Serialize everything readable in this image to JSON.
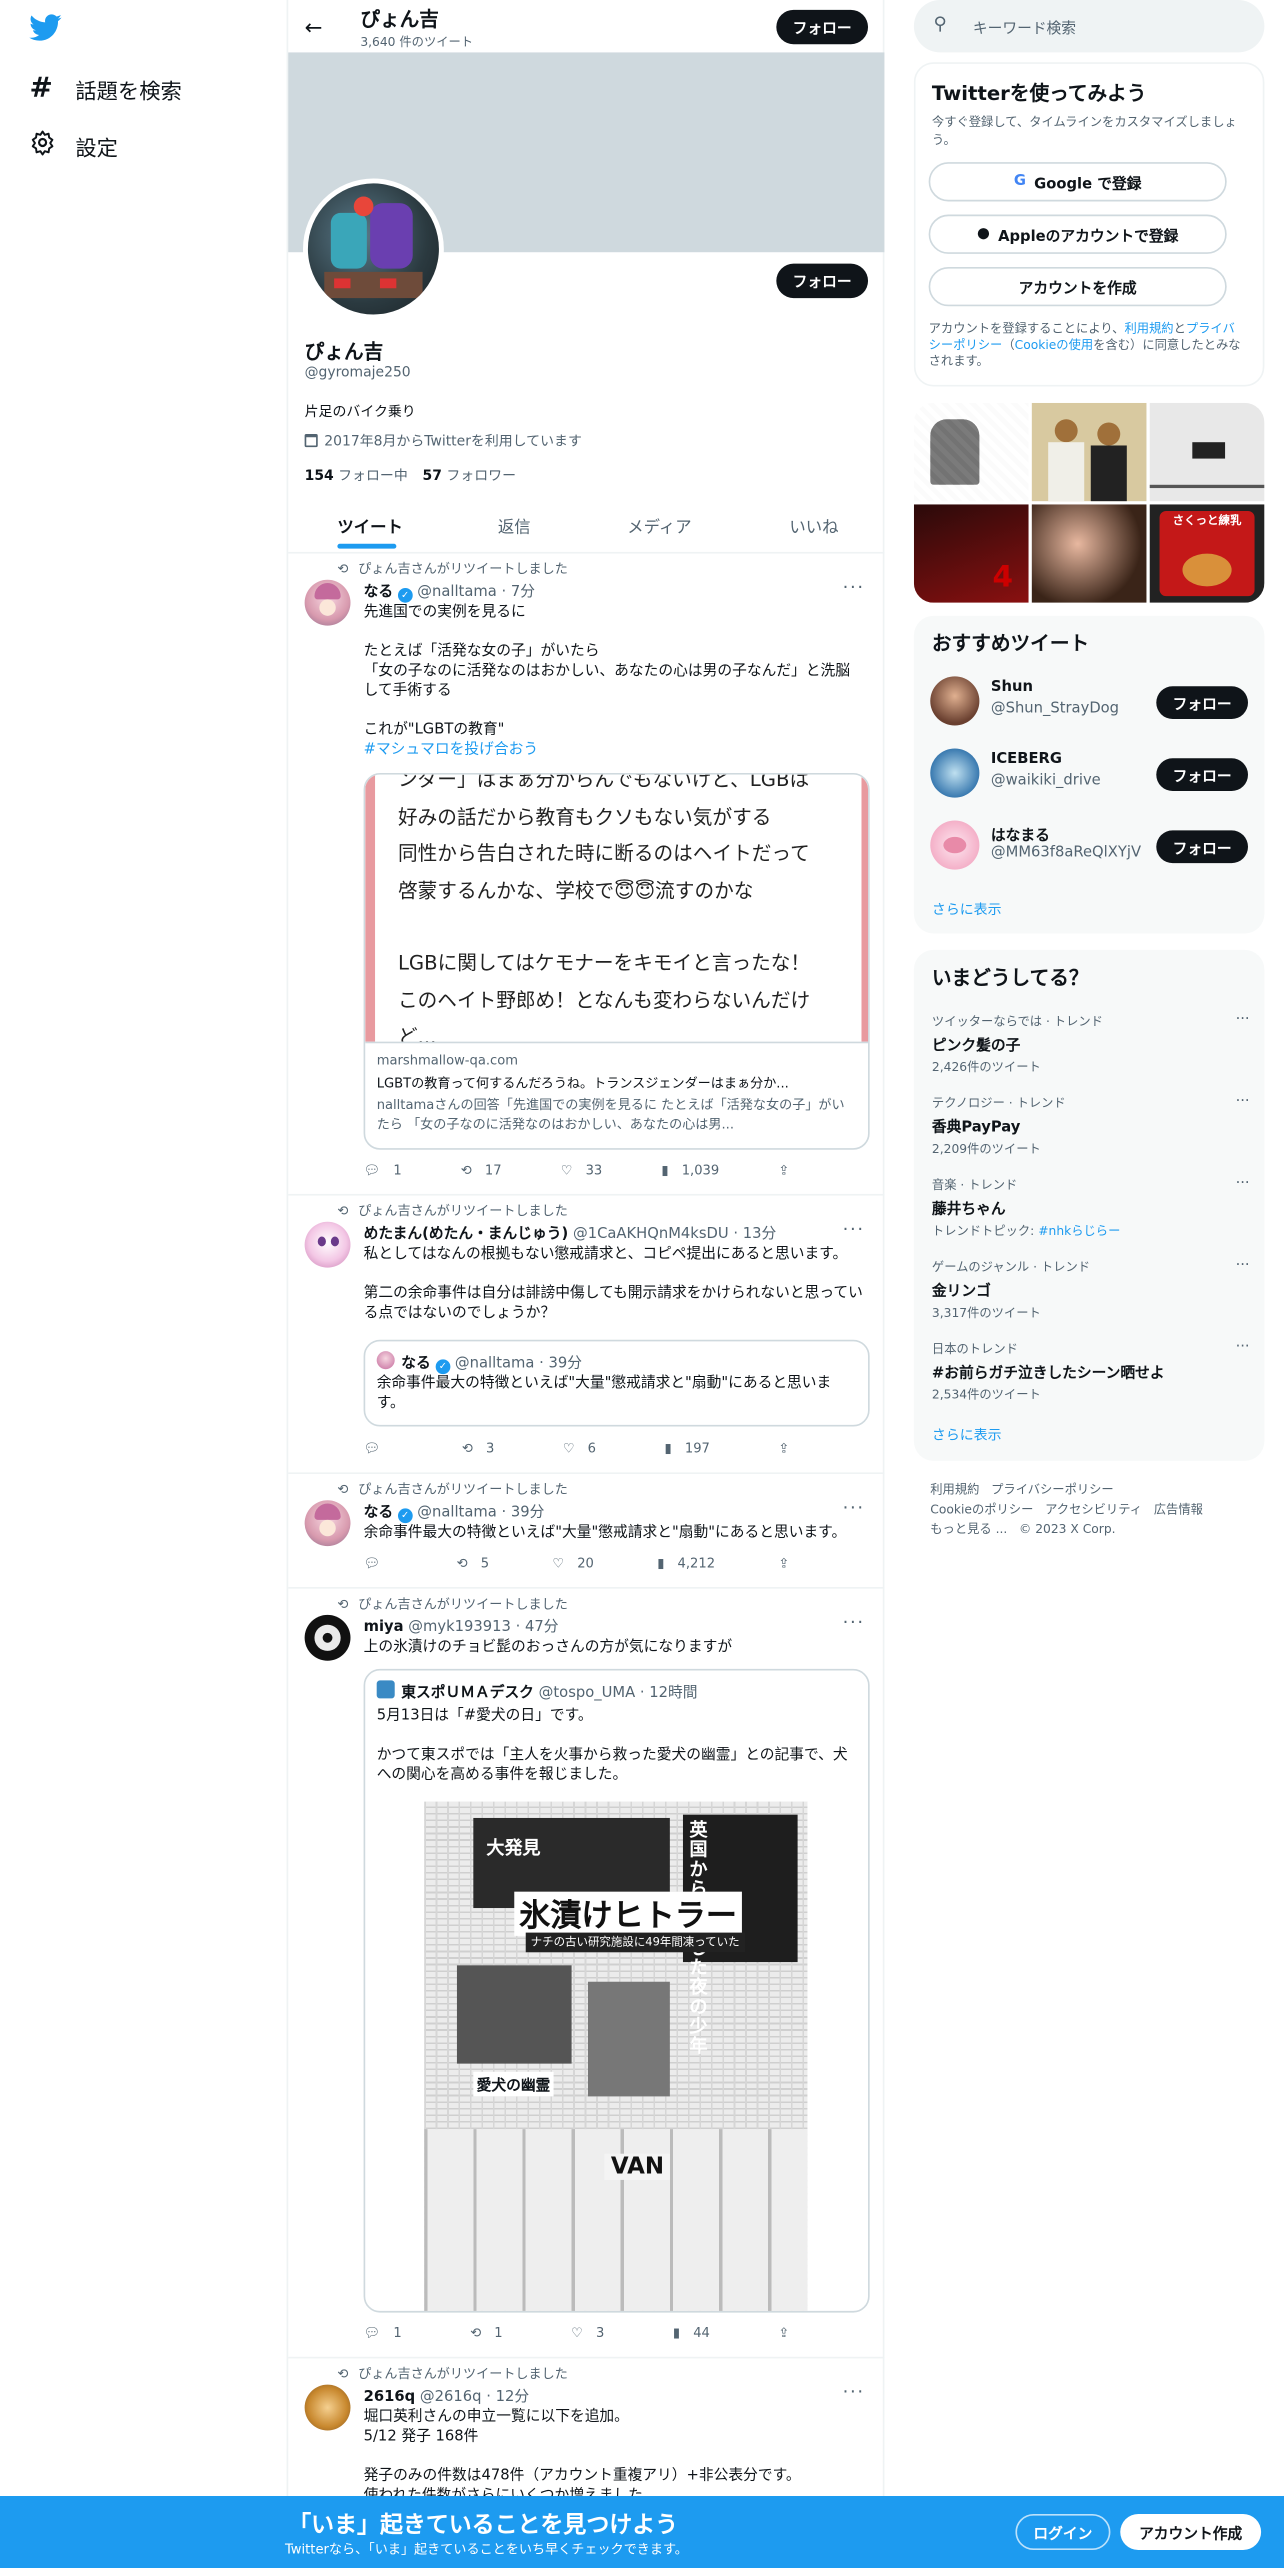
{
  "nav": {
    "explore_label": "話題を検索",
    "settings_label": "設定"
  },
  "profile_header": {
    "name": "ぴょん吉",
    "tweet_count": "3,640 件のツイート",
    "follow_label": "フォロー"
  },
  "profile": {
    "name": "ぴょん吉",
    "handle": "@gyromaje250",
    "bio": "片足のバイク乗り",
    "joined": "2017年8月からTwitterを利用しています",
    "following_count": "154",
    "following_label": "フォロー中",
    "followers_count": "57",
    "followers_label": "フォロワー",
    "follow_label": "フォロー"
  },
  "tabs": [
    {
      "label": "ツイート",
      "active": true
    },
    {
      "label": "返信"
    },
    {
      "label": "メディア"
    },
    {
      "label": "いいね"
    }
  ],
  "tweets": [
    {
      "rt_text": "ぴょん吉さんがリツイートしました",
      "name": "なる",
      "handle": "@nalltama",
      "time": "· 7分",
      "lines": [
        "先進国での実例を見るに",
        "",
        "たとえば「活発な女の子」がいたら",
        "「女の子なのに活発なのはおかしい、あなたの心は男の子なんだ」と洗脳して手術する",
        "",
        "これが\"LGBTの教育\""
      ],
      "hashtag": "#マシュマロを投げ合おう",
      "card": {
        "image_lines": [
          "ンダー」はまぁ分からんでもないけど、LGBは",
          "好みの話だから教育もクソもない気がする",
          "同性から告白された時に断るのはヘイトだって",
          "啓蒙するんかな、学校で😇😇流すのかな",
          "",
          "LGBに関してはケモナーをキモイと言ったな！",
          "このヘイト野郎め！となんも変わらないんだけ",
          "ど..."
        ],
        "domain": "marshmallow-qa.com",
        "title": "LGBTの教育って何するんだろうね。トランスジェンダーはまぁ分か...",
        "desc": "nalltamaさんの回答「先進国での実例を見るに たとえば「活発な女の子」がいたら 「女の子なのに活発なのはおかしい、あなたの心は男..."
      },
      "replies": "1",
      "retweets": "17",
      "likes": "33",
      "views": "1,039"
    },
    {
      "rt_text": "ぴょん吉さんがリツイートしました",
      "name": "めたまん(めたん・まんじゅう)",
      "handle": "@1CaAKHQnM4ksDU",
      "time": "· 13分",
      "lines": [
        "私としてはなんの根拠もない懲戒請求と、コピペ提出にあると思います。",
        "",
        "第二の余命事件は自分は誹謗中傷しても開示請求をかけられないと思っている点ではないのでしょうか？"
      ],
      "quote": {
        "name": "なる",
        "handle": "@nalltama",
        "time": "· 39分",
        "text": "余命事件最大の特徴といえば\"大量\"懲戒請求と\"扇動\"にあると思います。"
      },
      "replies": "",
      "retweets": "3",
      "likes": "6",
      "views": "197"
    },
    {
      "rt_text": "ぴょん吉さんがリツイートしました",
      "name": "なる",
      "handle": "@nalltama",
      "time": "· 39分",
      "lines": [
        "余命事件最大の特徴といえば\"大量\"懲戒請求と\"扇動\"にあると思います。"
      ],
      "replies": "",
      "retweets": "5",
      "likes": "20",
      "views": "4,212"
    },
    {
      "rt_text": "ぴょん吉さんがリツイートしました",
      "name": "miya",
      "handle": "@myk193913",
      "time": "· 47分",
      "lines": [
        "上の氷漬けのチョビ髭のおっさんの方が気になりますが"
      ],
      "quote": {
        "name": "東スポＵＭＡデスク",
        "handle": "@tospo_UMA",
        "time": "· 12時間",
        "lines": [
          "5月13日は「#愛犬の日」です。",
          "",
          "かつて東スポでは「主人を火事から救った愛犬の幽霊」との記事で、犬への関心を高める事件を報じました。"
        ],
        "paper": {
          "headline": "氷漬けヒトラー",
          "sub": "ナチの古い研究施設に49年間凍っていた",
          "side": "英国から生還した夜の少年",
          "side2": "愛犬の幽霊",
          "top": "大発見"
        }
      },
      "replies": "1",
      "retweets": "1",
      "likes": "3",
      "views": "44"
    },
    {
      "rt_text": "ぴょん吉さんがリツイートしました",
      "name": "2616q",
      "handle": "@2616q",
      "time": "· 12分",
      "lines": [
        "堀口英利さんの申立一覧に以下を追加。",
        "5/12 発子 168件",
        "",
        "発子のみの件数は478件（アカウント重複アリ）+非公表分です。",
        "使われた件数がさらにいくつか増えました。"
      ]
    }
  ],
  "search": {
    "placeholder": "キーワード検索"
  },
  "signup": {
    "title": "Twitterを使ってみよう",
    "subtitle": "今すぐ登録して、タイムラインをカスタマイズしましょう。",
    "google_label": "Google で登録",
    "apple_label": "Appleのアカウントで登録",
    "create_label": "アカウントを作成",
    "terms_prefix": "アカウントを登録することにより、",
    "terms_link": "利用規約",
    "terms_mid": "と",
    "privacy_link": "プライバシーポリシー",
    "cookie_open": "（",
    "cookie_link": "Cookieの使用",
    "terms_suffix": "を含む）に同意したとみなされます。"
  },
  "media_grid_alt": [
    "manga-art",
    "comedians",
    "machine",
    "movie-poster",
    "woman",
    "snack-package"
  ],
  "media_texts": {
    "movie_number": "4",
    "snack_label": "さくっと練乳"
  },
  "suggested": {
    "title": "おすすめツイート",
    "users": [
      {
        "name": "Shun",
        "handle": "@Shun_StrayDog",
        "follow": "フォロー"
      },
      {
        "name": "ICEBERG",
        "handle": "@waikiki_drive",
        "follow": "フォロー"
      },
      {
        "name": "はなまる",
        "handle": "@MM63f8aReQlXYjV",
        "follow": "フォロー"
      }
    ],
    "more": "さらに表示"
  },
  "trends": {
    "title": "いまどうしてる？",
    "items": [
      {
        "category": "ツイッターならでは · トレンド",
        "name": "ピンク髪の子",
        "count": "2,426件のツイート"
      },
      {
        "category": "テクノロジー · トレンド",
        "name": "香典PayPay",
        "count": "2,209件のツイート"
      },
      {
        "category": "音楽 · トレンド",
        "name": "藤井ちゃん",
        "topic_prefix": "トレンドトピック: ",
        "topic": "#nhkらじらー"
      },
      {
        "category": "ゲームのジャンル · トレンド",
        "name": "金リンゴ",
        "count": "3,317件のツイート"
      },
      {
        "category": "日本のトレンド",
        "name": "#お前らガチ泣きしたシーン晒せよ",
        "count": "2,534件のツイート"
      }
    ],
    "more": "さらに表示"
  },
  "footer": {
    "links": [
      "利用規約",
      "プライバシーポリシー",
      "Cookieのポリシー",
      "アクセシビリティ",
      "広告情報",
      "もっと見る ..."
    ],
    "copyright": "© 2023 X Corp."
  },
  "banner": {
    "title": "「いま」起きていることを見つけよう",
    "subtitle": "Twitterなら、「いま」起きていることをいち早くチェックできます。",
    "login": "ログイン",
    "signup": "アカウント作成"
  },
  "colors": {
    "accent": "#1d9bf0",
    "text": "#0f1419",
    "muted": "#536471",
    "banner": "#cfd9de",
    "pink": "#f4212e"
  }
}
